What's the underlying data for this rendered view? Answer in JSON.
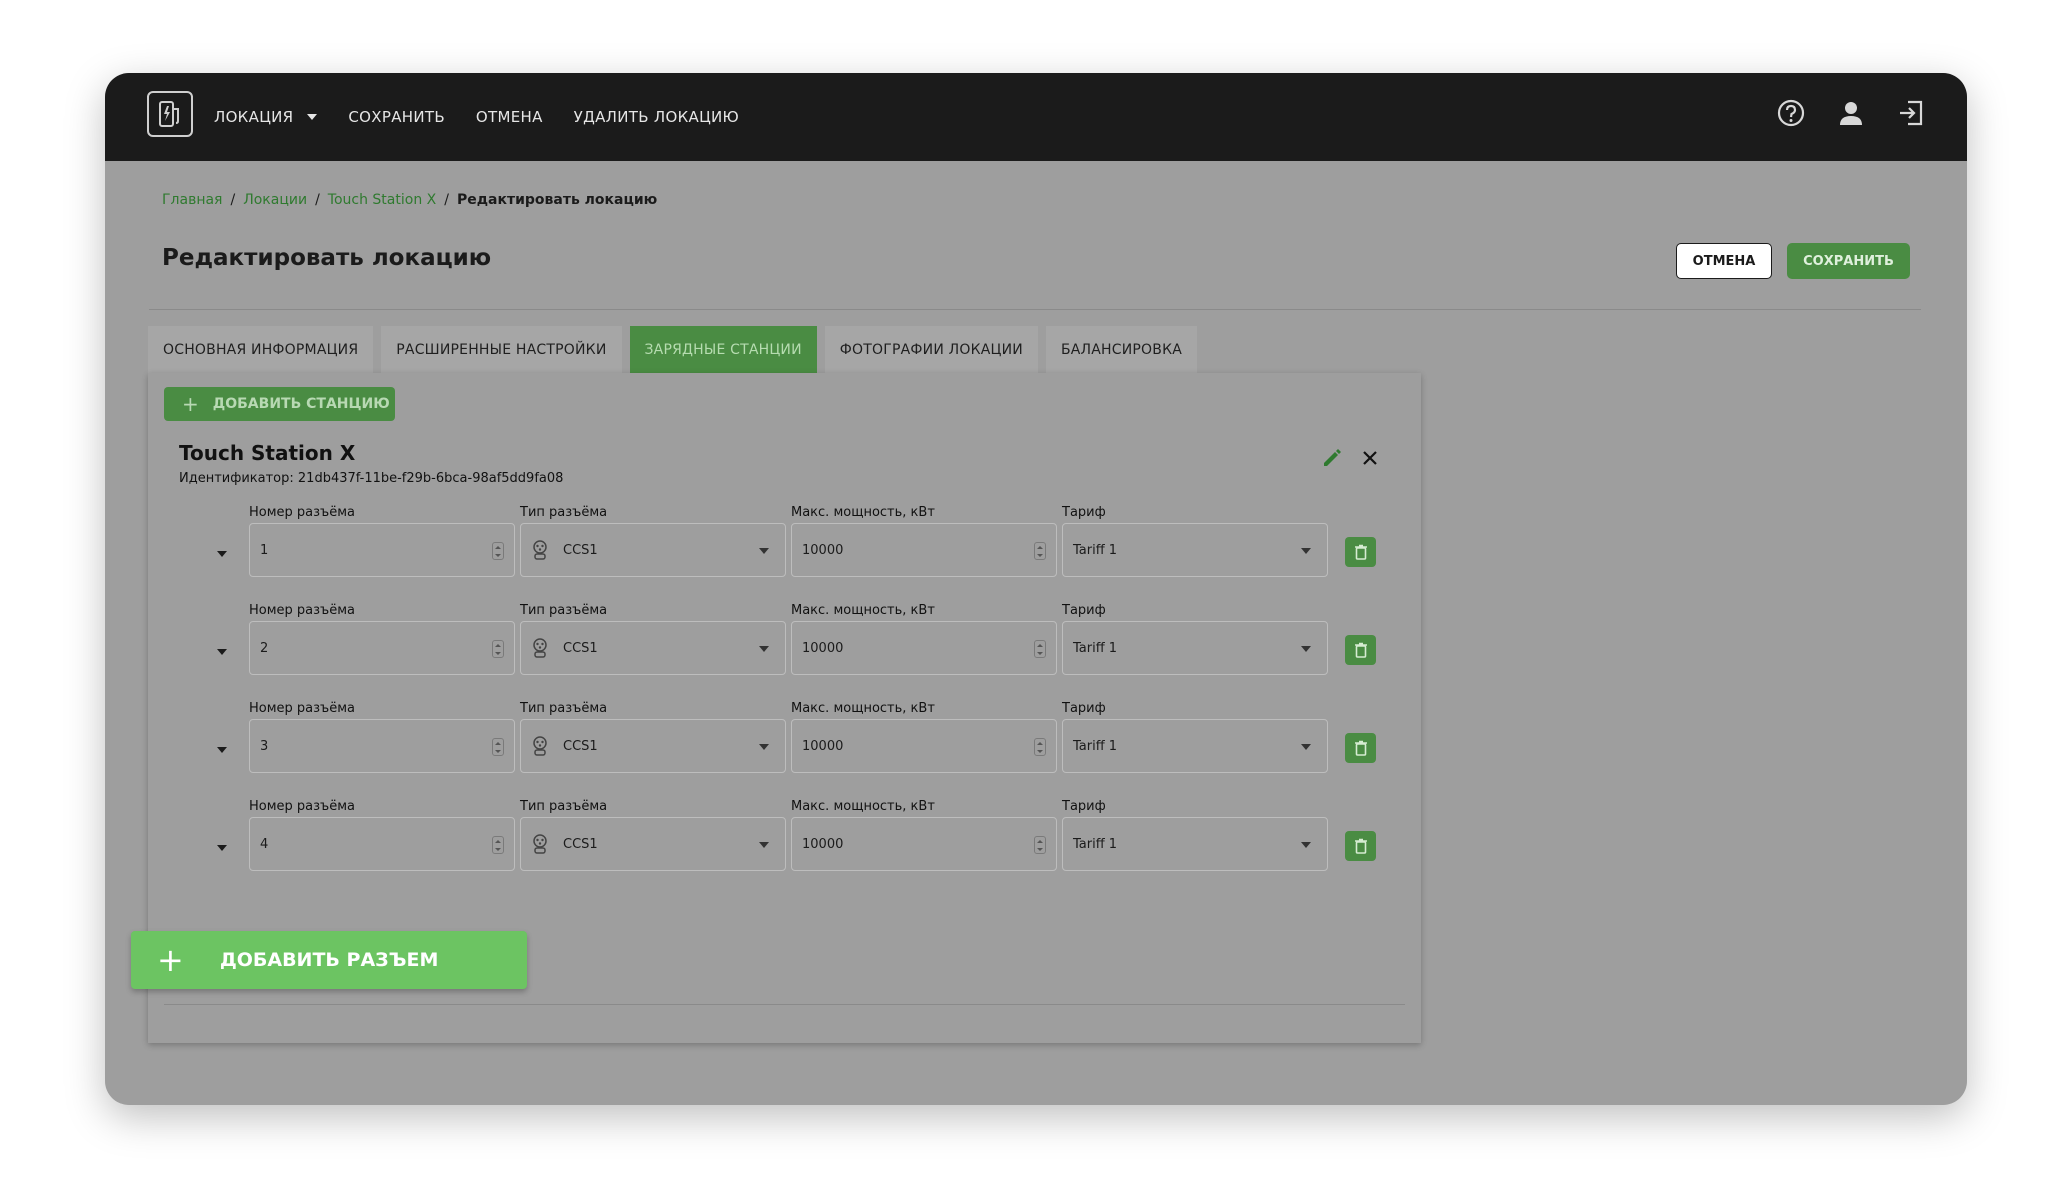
{
  "nav": {
    "items": [
      {
        "label": "ЛОКАЦИЯ",
        "has_dropdown": true
      },
      {
        "label": "СОХРАНИТЬ",
        "has_dropdown": false
      },
      {
        "label": "ОТМЕНА",
        "has_dropdown": false
      },
      {
        "label": "УДАЛИТЬ ЛОКАЦИЮ",
        "has_dropdown": false
      }
    ],
    "icons": [
      "help-icon",
      "user-icon",
      "logout-icon"
    ]
  },
  "breadcrumb": {
    "items": [
      "Главная",
      "Локации",
      "Touch Station X"
    ],
    "current": "Редактировать локацию"
  },
  "header": {
    "title": "Редактировать локацию",
    "cancel_label": "ОТМЕНА",
    "save_label": "СОХРАНИТЬ"
  },
  "tabs": [
    {
      "label": "ОСНОВНАЯ ИНФОРМАЦИЯ",
      "active": false
    },
    {
      "label": "РАСШИРЕННЫЕ НАСТРОЙКИ",
      "active": false
    },
    {
      "label": "ЗАРЯДНЫЕ СТАНЦИИ",
      "active": true
    },
    {
      "label": "ФОТОГРАФИИ ЛОКАЦИИ",
      "active": false
    },
    {
      "label": "БАЛАНСИРОВКА",
      "active": false
    }
  ],
  "panel": {
    "add_station_label": "ДОБАВИТЬ СТАНЦИЮ",
    "station": {
      "name": "Touch Station X",
      "id_text": "Идентификатор: 21db437f-11be-f29b-6bca-98af5dd9fa08"
    },
    "field_labels": {
      "number": "Номер разъёма",
      "type": "Тип разъёма",
      "power": "Макс. мощность, кВт",
      "tariff": "Тариф"
    },
    "connectors": [
      {
        "number": "1",
        "type": "CCS1",
        "power": "10000",
        "tariff": "Tariff 1"
      },
      {
        "number": "2",
        "type": "CCS1",
        "power": "10000",
        "tariff": "Tariff 1"
      },
      {
        "number": "3",
        "type": "CCS1",
        "power": "10000",
        "tariff": "Tariff 1"
      },
      {
        "number": "4",
        "type": "CCS1",
        "power": "10000",
        "tariff": "Tariff 1"
      }
    ],
    "add_connector_label": "ДОБАВИТЬ РАЗЪЕМ"
  },
  "colors": {
    "accent": "#4a8c43",
    "accent_light": "#6cc462",
    "topbar": "#1b1b1b",
    "background": "#9e9e9e"
  }
}
